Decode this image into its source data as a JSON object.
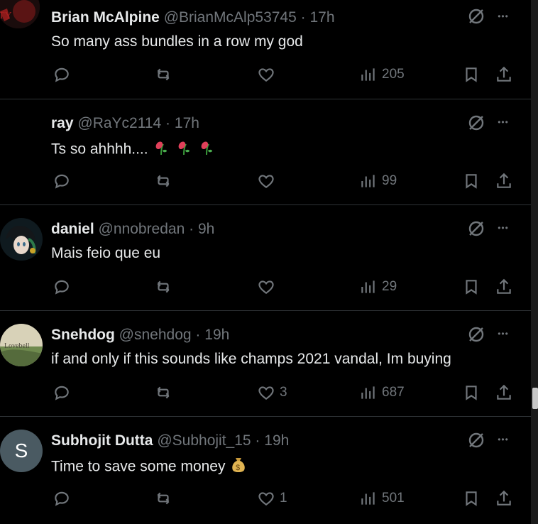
{
  "tweets": [
    {
      "name": "Brian McAlpine",
      "handle": "@BrianMcAlp53745",
      "dot": "·",
      "time": "17h",
      "text": "So many ass bundles in a row my god",
      "likes": "",
      "views": "205",
      "avatar": "dark-red-artwork-avatar"
    },
    {
      "name": "ray",
      "handle": "@RaYc2114",
      "dot": "·",
      "time": "17h",
      "text": "Ts so ahhhh....",
      "emoji": "wilted-flower-emoji ×3",
      "likes": "",
      "views": "99",
      "avatar": "black-avatar"
    },
    {
      "name": "daniel",
      "handle": "@nnobredan",
      "dot": "·",
      "time": "9h",
      "text": "Mais feio que eu",
      "likes": "",
      "views": "29",
      "avatar": "anime-character-avatar"
    },
    {
      "name": "Snehdog",
      "handle": "@snehdog",
      "dot": "·",
      "time": "19h",
      "text": "if and only if this sounds like champs 2021 vandal, Im buying",
      "likes": "3",
      "views": "687",
      "avatar": "landscape-avatar",
      "avatar_text": "Lovebell"
    },
    {
      "name": "Subhojit Dutta",
      "handle": "@Subhojit_15",
      "dot": "·",
      "time": "19h",
      "text": "Time to save some money",
      "emoji": "money-bag-emoji",
      "likes": "1",
      "views": "501",
      "avatar": "letter-avatar",
      "avatar_letter": "S"
    }
  ],
  "more_label": "•••",
  "colors": {
    "background": "#000000",
    "text": "#e7e9ea",
    "secondary": "#71767b",
    "divider": "#2f3336"
  }
}
